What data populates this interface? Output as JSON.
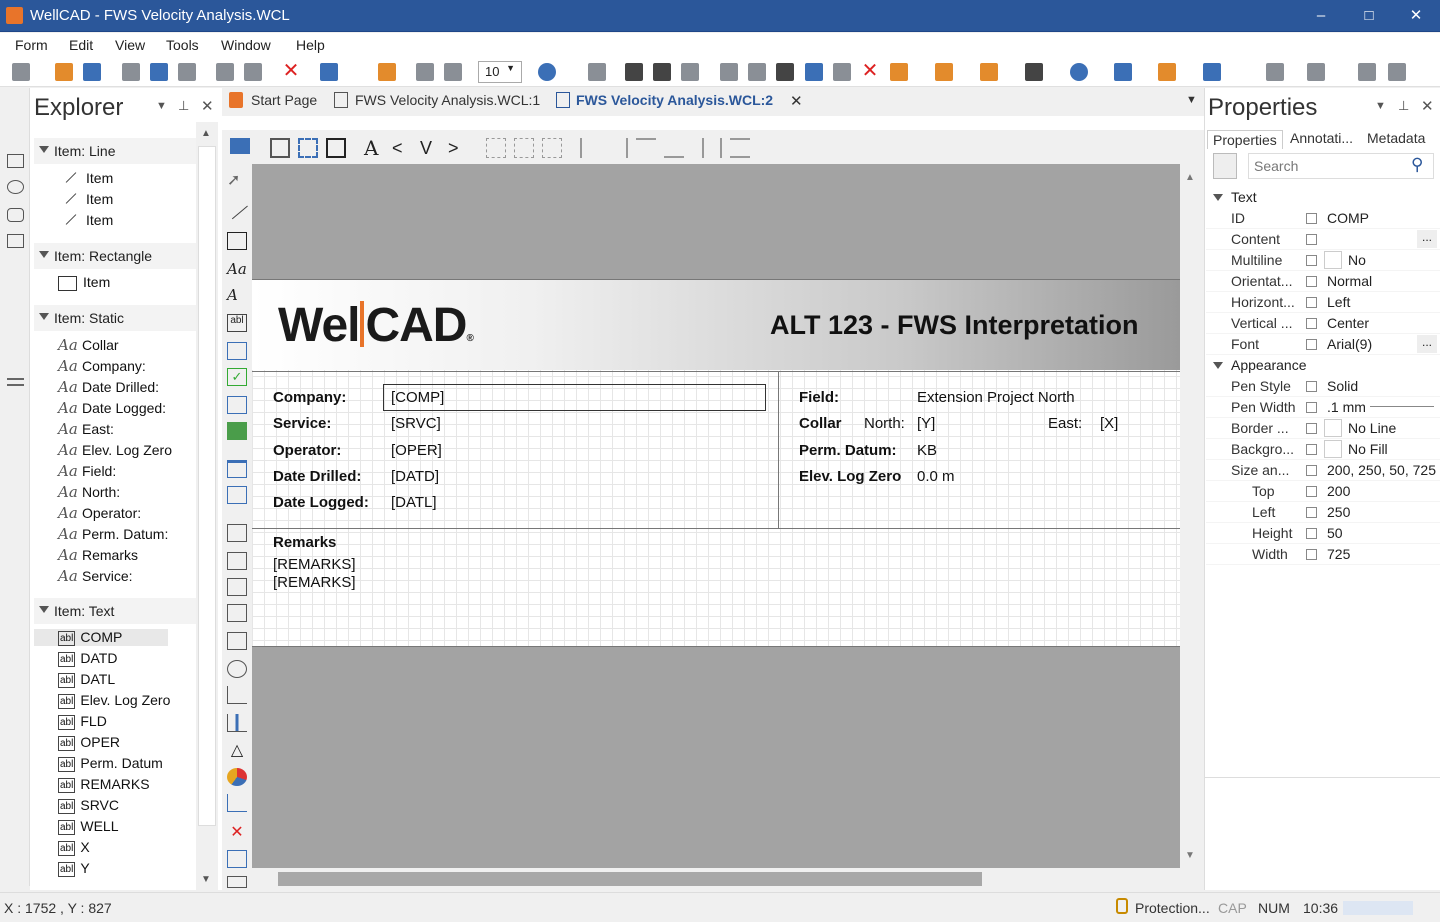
{
  "window": {
    "title": "WellCAD - FWS Velocity Analysis.WCL",
    "minimize": "–",
    "maximize": "□",
    "close": "✕"
  },
  "menu": [
    "Form",
    "Edit",
    "View",
    "Tools",
    "Window",
    "Help"
  ],
  "toolbar": {
    "zoom": "10"
  },
  "explorer": {
    "title": "Explorer",
    "groups": {
      "line": {
        "label": "Item: Line",
        "items": [
          "Item",
          "Item",
          "Item"
        ]
      },
      "rect": {
        "label": "Item: Rectangle",
        "items": [
          "Item"
        ]
      },
      "static": {
        "label": "Item: Static",
        "items": [
          "Collar",
          "Company:",
          "Date Drilled:",
          "Date Logged:",
          "East:",
          "Elev. Log Zero",
          "Field:",
          "North:",
          "Operator:",
          "Perm. Datum:",
          "Remarks",
          "Service:"
        ]
      },
      "text": {
        "label": "Item: Text",
        "items": [
          "COMP",
          "DATD",
          "DATL",
          "Elev. Log Zero",
          "FLD",
          "OPER",
          "Perm. Datum",
          "REMARKS",
          "SRVC",
          "WELL",
          "X",
          "Y"
        ]
      }
    }
  },
  "tabs": {
    "start": "Start Page",
    "doc1": "FWS Velocity Analysis.WCL:1",
    "doc2": "FWS Velocity Analysis.WCL:2"
  },
  "form": {
    "logo_left": "Wel",
    "logo_right": "CAD",
    "logo_reg": "®",
    "title": "ALT 123 - FWS Interpretation",
    "left": {
      "labels": [
        "Company:",
        "Service:",
        "Operator:",
        "Date Drilled:",
        "Date Logged:"
      ],
      "values": [
        "[COMP]",
        "[SRVC]",
        "[OPER]",
        "[DATD]",
        "[DATL]"
      ]
    },
    "right": {
      "field_label": "Field:",
      "field_value": "Extension Project  North",
      "collar_label": "Collar",
      "north_label": "North:",
      "north_value": "[Y]",
      "east_label": "East:",
      "east_value": "[X]",
      "datum_label": "Perm. Datum:",
      "datum_value": "KB",
      "elev_label": "Elev. Log Zero",
      "elev_value": "0.0 m"
    },
    "remarks_label": "Remarks",
    "remarks_values": [
      "[REMARKS]",
      "[REMARKS]"
    ]
  },
  "properties": {
    "title": "Properties",
    "tabs": [
      "Properties",
      "Annotati...",
      "Metadata"
    ],
    "search_placeholder": "Search",
    "cat_text": "Text",
    "cat_appearance": "Appearance",
    "ellipsis": "...",
    "rows": [
      {
        "name": "ID",
        "value": "COMP"
      },
      {
        "name": "Content",
        "value": ""
      },
      {
        "name": "Multiline",
        "value": "No"
      },
      {
        "name": "Orientat...",
        "value": "Normal"
      },
      {
        "name": "Horizont...",
        "value": "Left"
      },
      {
        "name": "Vertical ...",
        "value": "Center"
      },
      {
        "name": "Font",
        "value": "Arial(9)"
      }
    ],
    "app_rows": [
      {
        "name": "Pen Style",
        "value": "Solid"
      },
      {
        "name": "Pen Width",
        "value": ".1 mm"
      },
      {
        "name": "Border ...",
        "value": "No Line"
      },
      {
        "name": "Backgro...",
        "value": "No Fill"
      },
      {
        "name": "Size an...",
        "value": "200, 250, 50, 725"
      },
      {
        "name": "Top",
        "value": "200"
      },
      {
        "name": "Left",
        "value": "250"
      },
      {
        "name": "Height",
        "value": "50"
      },
      {
        "name": "Width",
        "value": "725"
      }
    ]
  },
  "status": {
    "coords": "X : 1752 , Y : 827",
    "protection": "Protection...",
    "cap": "CAP",
    "num": "NUM",
    "time": "10:36"
  }
}
